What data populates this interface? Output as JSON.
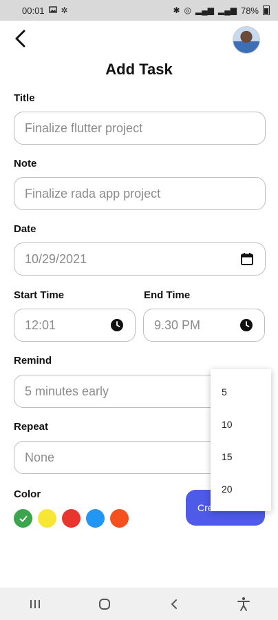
{
  "status_bar": {
    "time": "00:01",
    "battery": "78%",
    "icons": [
      "image-icon",
      "pinwheel-icon",
      "bluetooth-icon",
      "hotspot-icon",
      "signal-icon",
      "signal-icon",
      "battery-icon"
    ]
  },
  "header": {
    "title": "Add Task",
    "back_icon": "back-arrow-icon",
    "avatar": "user-avatar"
  },
  "form": {
    "title": {
      "label": "Title",
      "value": "Finalize flutter project"
    },
    "note": {
      "label": "Note",
      "value": "Finalize rada app project"
    },
    "date": {
      "label": "Date",
      "value": "10/29/2021",
      "icon": "calendar-icon"
    },
    "start_time": {
      "label": "Start Time",
      "value": "12:01",
      "icon": "clock-icon"
    },
    "end_time": {
      "label": "End Time",
      "value": "9.30 PM",
      "icon": "clock-icon"
    },
    "remind": {
      "label": "Remind",
      "value": "5 minutes early"
    },
    "repeat": {
      "label": "Repeat",
      "value": "None"
    },
    "color": {
      "label": "Color",
      "options": [
        "#3aa54a",
        "#f7e634",
        "#e8362f",
        "#2196f3",
        "#f4511e"
      ],
      "selected_index": 0
    }
  },
  "create_button": {
    "label": "Create Task",
    "visible_label": "Cre",
    "color": "#4e5ae8"
  },
  "remind_dropdown": {
    "options": [
      "5",
      "10",
      "15",
      "20"
    ]
  },
  "nav_bar": {
    "items": [
      "recents-icon",
      "home-icon",
      "back-icon",
      "accessibility-icon"
    ]
  }
}
